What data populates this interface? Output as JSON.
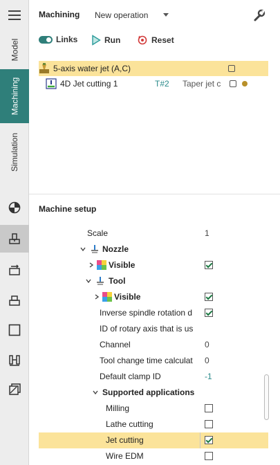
{
  "sidebar": {
    "tabs": [
      {
        "label": "Model"
      },
      {
        "label": "Machining"
      },
      {
        "label": "Simulation"
      }
    ],
    "tool_icons": [
      "sphere-quadrant-icon",
      "machine-setup-icon",
      "stock-transfer-icon",
      "workpiece-icon",
      "blank-square-icon",
      "fixture-clamp-icon",
      "layer-stack-icon"
    ]
  },
  "header": {
    "title": "Machining",
    "operation": "New operation"
  },
  "toolbar": {
    "links": "Links",
    "run": "Run",
    "reset": "Reset"
  },
  "operations": [
    {
      "name": "5-axis water jet (A,C)"
    },
    {
      "name": "4D Jet cutting 1",
      "tool": "T#2",
      "desc": "Taper jet c"
    }
  ],
  "machine_setup": {
    "title": "Machine setup",
    "rows": [
      {
        "label": "Scale",
        "value": "1"
      },
      {
        "label": "Nozzle"
      },
      {
        "label": "Visible",
        "checked": true
      },
      {
        "label": "Tool"
      },
      {
        "label": "Visible",
        "checked": true
      },
      {
        "label": "Inverse spindle rotation d",
        "checked": true
      },
      {
        "label": "ID of rotary axis that is us"
      },
      {
        "label": "Channel",
        "value": "0"
      },
      {
        "label": "Tool change time calculat",
        "value": "0"
      },
      {
        "label": "Default clamp ID",
        "value": "-1"
      },
      {
        "label": "Supported applications"
      },
      {
        "label": "Milling",
        "checked": false
      },
      {
        "label": "Lathe cutting",
        "checked": false
      },
      {
        "label": "Jet cutting",
        "checked": true
      },
      {
        "label": "Wire EDM",
        "checked": false
      }
    ]
  },
  "colors": {
    "accent": "#2f7f7a",
    "highlight": "#fbe39a",
    "run": "#2a9a9a",
    "reset": "#d23a3a"
  }
}
